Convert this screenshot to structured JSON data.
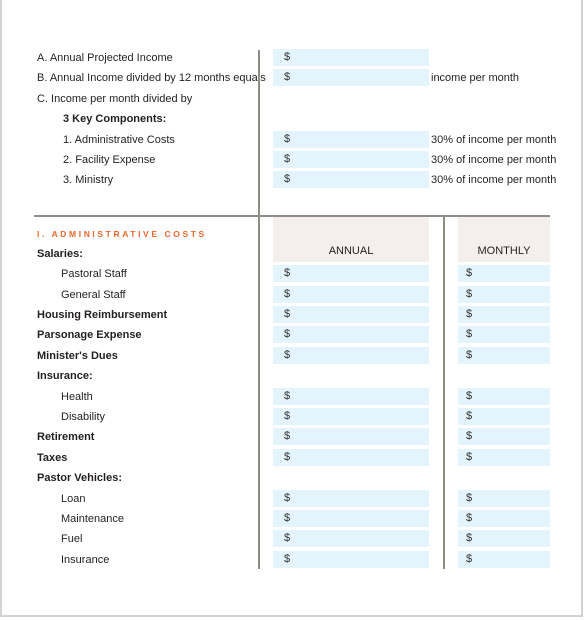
{
  "summary": {
    "rows": [
      {
        "label": "A. Annual Projected Income",
        "field": "$",
        "note": ""
      },
      {
        "label": "B. Annual Income divided by 12 months equals",
        "field": "$",
        "note": "income per month"
      },
      {
        "label": "C. Income per month divided by",
        "field": null,
        "note": ""
      },
      {
        "label": "3 Key Components:",
        "field": null,
        "note": ""
      },
      {
        "label": "1. Administrative Costs",
        "field": "$",
        "note": "30% of income per month"
      },
      {
        "label": "2. Facility Expense",
        "field": "$",
        "note": "30% of income per month"
      },
      {
        "label": "3. Ministry",
        "field": "$",
        "note": "30% of income per month"
      }
    ]
  },
  "admin": {
    "section_title": "I. ADMINISTRATIVE COSTS",
    "columns": {
      "annual": "ANNUAL",
      "monthly": "MONTHLY"
    },
    "currency": "$",
    "rows": [
      {
        "label": "Salaries:",
        "bold": true,
        "indent": false,
        "fields": false
      },
      {
        "label": "Pastoral Staff",
        "bold": false,
        "indent": true,
        "fields": true
      },
      {
        "label": "General Staff",
        "bold": false,
        "indent": true,
        "fields": true
      },
      {
        "label": "Housing Reimbursement",
        "bold": true,
        "indent": false,
        "fields": true
      },
      {
        "label": "Parsonage Expense",
        "bold": true,
        "indent": false,
        "fields": true
      },
      {
        "label": "Minister's Dues",
        "bold": true,
        "indent": false,
        "fields": true
      },
      {
        "label": "Insurance:",
        "bold": true,
        "indent": false,
        "fields": false
      },
      {
        "label": "Health",
        "bold": false,
        "indent": true,
        "fields": true
      },
      {
        "label": "Disability",
        "bold": false,
        "indent": true,
        "fields": true
      },
      {
        "label": "Retirement",
        "bold": true,
        "indent": false,
        "fields": true
      },
      {
        "label": "Taxes",
        "bold": true,
        "indent": false,
        "fields": true
      },
      {
        "label": "Pastor Vehicles:",
        "bold": true,
        "indent": false,
        "fields": false
      },
      {
        "label": "Loan",
        "bold": false,
        "indent": true,
        "fields": true
      },
      {
        "label": "Maintenance",
        "bold": false,
        "indent": true,
        "fields": true
      },
      {
        "label": "Fuel",
        "bold": false,
        "indent": true,
        "fields": true
      },
      {
        "label": "Insurance",
        "bold": false,
        "indent": true,
        "fields": true
      }
    ]
  },
  "colors": {
    "field_bg": "#e3f4fc",
    "header_bg": "#f4efec",
    "accent": "#e8692c",
    "rule": "#8f8c86"
  }
}
